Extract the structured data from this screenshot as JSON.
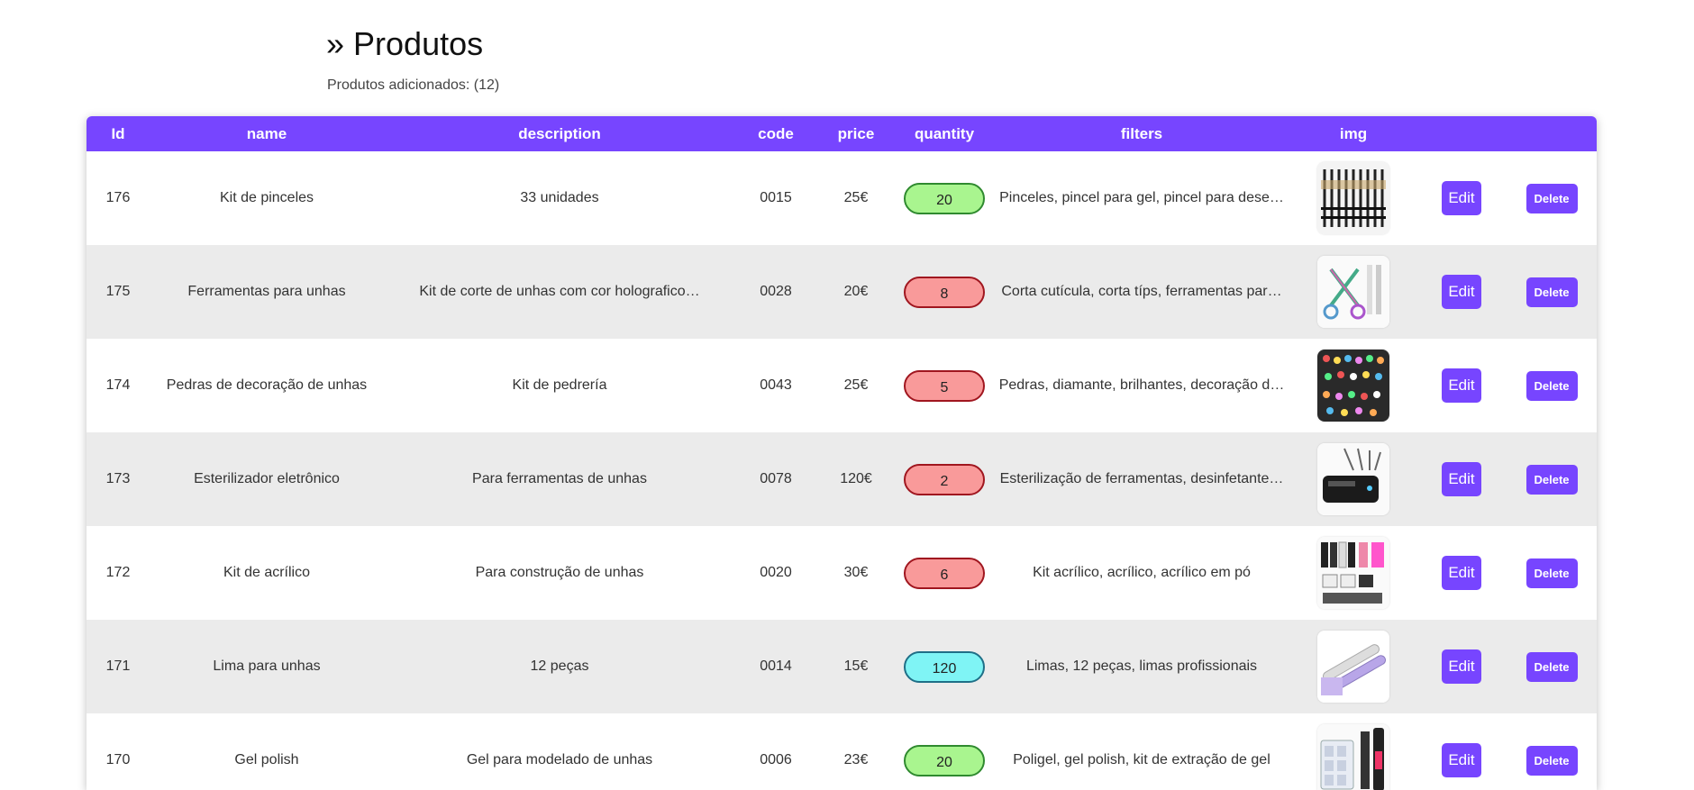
{
  "header": {
    "title": "» Produtos",
    "subtitle": "Produtos adicionados: (12)"
  },
  "colors": {
    "accent": "#7745ff",
    "row_alt": "#ebebeb",
    "qty_green": "#a9f58f",
    "qty_red": "#f99a9a",
    "qty_cyan": "#7ff4f5"
  },
  "table": {
    "columns": [
      "Id",
      "name",
      "description",
      "code",
      "price",
      "quantity",
      "filters",
      "img",
      "",
      ""
    ],
    "edit_label": "Edit",
    "delete_label": "Delete",
    "rows": [
      {
        "id": "176",
        "name": "Kit de pinceles",
        "description": "33 unidades",
        "code": "0015",
        "price": "25€",
        "quantity": "20",
        "qty_status": "green",
        "filters": "Pinceles, pincel para gel, pincel para dese…",
        "img_icon": "brushes-image"
      },
      {
        "id": "175",
        "name": "Ferramentas para unhas",
        "description": "Kit de corte de unhas com cor holografico…",
        "code": "0028",
        "price": "20€",
        "quantity": "8",
        "qty_status": "red",
        "filters": "Corta cutícula, corta típs, ferramentas par…",
        "img_icon": "nail-tools-image"
      },
      {
        "id": "174",
        "name": "Pedras de decoração de unhas",
        "description": "Kit de pedrería",
        "code": "0043",
        "price": "25€",
        "quantity": "5",
        "qty_status": "red",
        "filters": "Pedras, diamante, brilhantes, decoração d…",
        "img_icon": "rhinestones-image"
      },
      {
        "id": "173",
        "name": "Esterilizador eletrônico",
        "description": "Para ferramentas de unhas",
        "code": "0078",
        "price": "120€",
        "quantity": "2",
        "qty_status": "red",
        "filters": "Esterilização de ferramentas, desinfetante…",
        "img_icon": "sterilizer-image"
      },
      {
        "id": "172",
        "name": "Kit de acrílico",
        "description": "Para construção de unhas",
        "code": "0020",
        "price": "30€",
        "quantity": "6",
        "qty_status": "red",
        "filters": "Kit acrílico, acrílico, acrílico em pó",
        "img_icon": "acrylic-kit-image"
      },
      {
        "id": "171",
        "name": "Lima para unhas",
        "description": "12 peças",
        "code": "0014",
        "price": "15€",
        "quantity": "120",
        "qty_status": "cyan",
        "filters": "Limas, 12 peças, limas profissionais",
        "img_icon": "nail-files-image"
      },
      {
        "id": "170",
        "name": "Gel polish",
        "description": "Gel para modelado de unhas",
        "code": "0006",
        "price": "23€",
        "quantity": "20",
        "qty_status": "green",
        "filters": "Poligel, gel polish, kit de extração de gel",
        "img_icon": "gel-polish-image"
      }
    ]
  }
}
